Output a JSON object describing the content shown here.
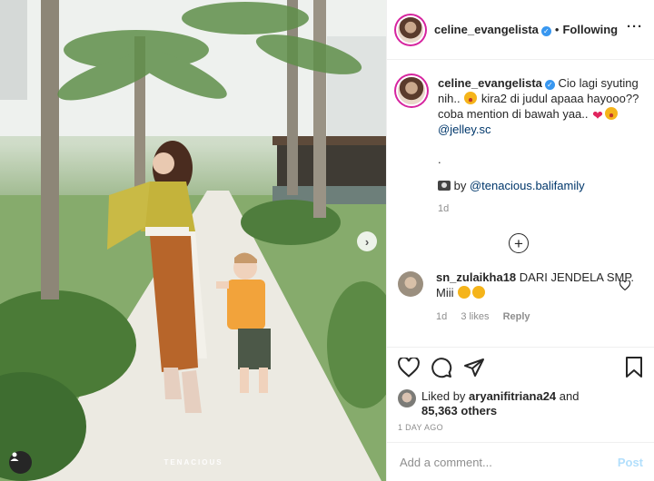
{
  "photo": {
    "watermark": "TENACIOUS",
    "next_icon": "chevron-right-icon",
    "tag_icon": "user-tag-icon"
  },
  "header": {
    "username": "celine_evangelista",
    "verified_icon": "verified-badge-icon",
    "separator": "•",
    "follow_status": "Following",
    "more_icon": "more-options-icon"
  },
  "caption": {
    "username": "celine_evangelista",
    "line1": "Cio lagi syuting nih..",
    "line1b": "kira2 di judul apaaa hayooo?? coba mention di bawah yaa..",
    "mention1": "@jelley.sc",
    "dot": ".",
    "by_prefix": "by",
    "mention2": "@tenacious.balifamily",
    "time": "1d"
  },
  "load_more_icon": "plus-circle-icon",
  "comment": {
    "username": "sn_zulaikha18",
    "text": "DARI JENDELA SMP. Miii",
    "time": "1d",
    "likes": "3 likes",
    "reply": "Reply"
  },
  "likes": {
    "prefix": "Liked by",
    "user": "aryanifitriana24",
    "and": "and",
    "count": "85,363 others"
  },
  "timestamp": "1 DAY AGO",
  "add_comment": {
    "placeholder": "Add a comment...",
    "post_label": "Post"
  },
  "colors": {
    "link": "#00376b",
    "post_disabled": "#b2dffc",
    "story_ring": "#d6249f",
    "verified": "#3897f0"
  }
}
